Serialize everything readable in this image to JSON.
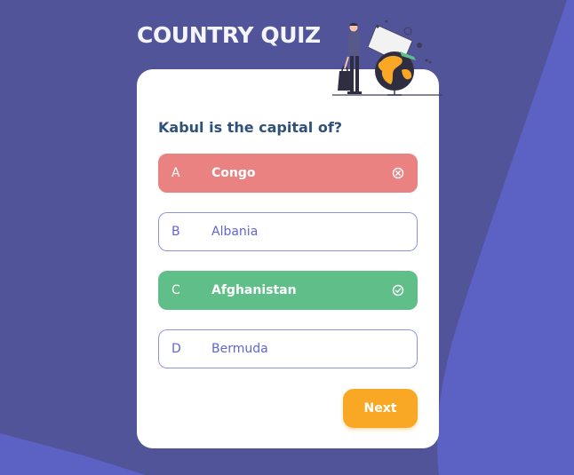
{
  "app": {
    "title": "COUNTRY QUIZ"
  },
  "question": {
    "text": "Kabul is the capital of?"
  },
  "options": [
    {
      "letter": "A",
      "text": "Congo",
      "state": "wrong",
      "icon": "close-circle-icon"
    },
    {
      "letter": "B",
      "text": "Albania",
      "state": "default",
      "icon": ""
    },
    {
      "letter": "C",
      "text": "Afghanistan",
      "state": "correct",
      "icon": "check-circle-icon"
    },
    {
      "letter": "D",
      "text": "Bermuda",
      "state": "default",
      "icon": ""
    }
  ],
  "actions": {
    "next_label": "Next"
  },
  "colors": {
    "background": "#52549a",
    "accent_shape": "#5c61c4",
    "card": "#ffffff",
    "title": "#f4f4fb",
    "question": "#2f527b",
    "option_default": "#6066d0",
    "option_wrong": "#ea8282",
    "option_correct": "#60bf88",
    "button": "#f9a826"
  },
  "illustration": {
    "icon": "traveler-with-globe-icon"
  }
}
